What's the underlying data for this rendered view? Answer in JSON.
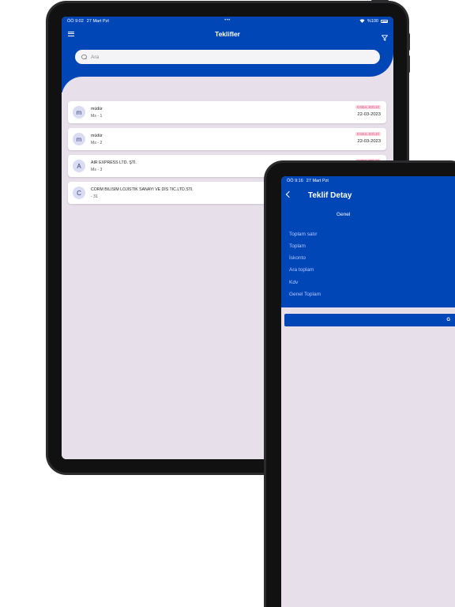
{
  "back_screen": {
    "status_bar": {
      "time": "ÖÖ 9:02",
      "date": "27 Mart Pzt",
      "battery": "%100"
    },
    "header": {
      "title": "Teklifler"
    },
    "search": {
      "placeholder": "Ara"
    },
    "offers": [
      {
        "avatar": "m",
        "name": "müdür",
        "sub": "Ms - 1",
        "badge": "KABUL EDİLDİ",
        "date": "22-03-2023"
      },
      {
        "avatar": "m",
        "name": "müdür",
        "sub": "Ms - 2",
        "badge": "KABUL EDİLDİ",
        "date": "22-03-2023"
      },
      {
        "avatar": "A",
        "name": "AIR EXPRESS LTD. ŞTİ.",
        "sub": "Ms - 3",
        "badge": "KABUL EDİLDİ",
        "date": "22-03-2023"
      },
      {
        "avatar": "C",
        "name": "CORM BILISIM LOJISTIK SANAYI VE DIS TIC.LTD.STI.",
        "sub": "- 31"
      }
    ]
  },
  "front_screen": {
    "status_bar": {
      "time": "ÖÖ 9:16",
      "date": "27 Mart Pzt"
    },
    "header": {
      "title": "Teklif Detay"
    },
    "subtitle": "Genel",
    "summary_labels": [
      "Toplam satır",
      "Toplam",
      "İskonto",
      "Ara toplam",
      "Kdv",
      "Genel Toplam"
    ],
    "action_button": "G"
  },
  "colors": {
    "primary_blue": "#0046b6",
    "screen_background": "#e7dfea",
    "badge_pink": "#fbd6e1",
    "avatar_bg": "#dadcf3"
  }
}
